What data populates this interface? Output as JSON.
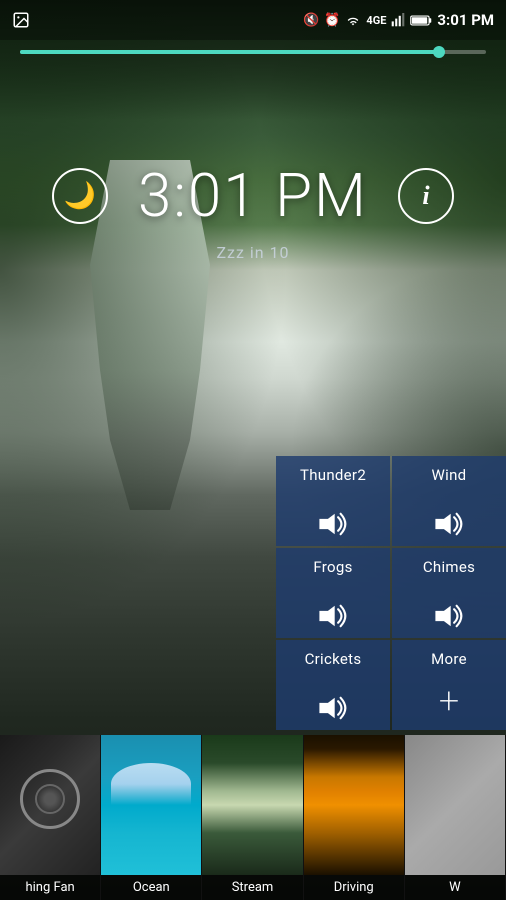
{
  "statusBar": {
    "time": "3:01 PM",
    "icons": {
      "volumeOff": "🔇",
      "alarm": "⏰",
      "wifi": "WiFi",
      "network": "4GE",
      "signal": "▲▲▲",
      "battery": "🔋"
    }
  },
  "progress": {
    "percent": 90
  },
  "clock": {
    "time": "3:01 PM",
    "zzz_label": "Zzz in 10"
  },
  "controls": {
    "moon_label": "🌙",
    "info_label": "i"
  },
  "soundTiles": [
    {
      "id": "thunder2",
      "label": "Thunder2",
      "type": "speaker"
    },
    {
      "id": "wind",
      "label": "Wind",
      "type": "speaker"
    },
    {
      "id": "frogs",
      "label": "Frogs",
      "type": "speaker"
    },
    {
      "id": "chimes",
      "label": "Chimes",
      "type": "speaker"
    },
    {
      "id": "crickets",
      "label": "Crickets",
      "type": "speaker"
    },
    {
      "id": "more",
      "label": "More",
      "type": "plus"
    }
  ],
  "thumbnails": [
    {
      "id": "fan",
      "label": "hing Fan",
      "theme": "fan"
    },
    {
      "id": "ocean",
      "label": "Ocean",
      "theme": "ocean"
    },
    {
      "id": "stream",
      "label": "Stream",
      "theme": "stream"
    },
    {
      "id": "driving",
      "label": "Driving",
      "theme": "driving"
    },
    {
      "id": "w",
      "label": "W",
      "theme": "last"
    }
  ]
}
